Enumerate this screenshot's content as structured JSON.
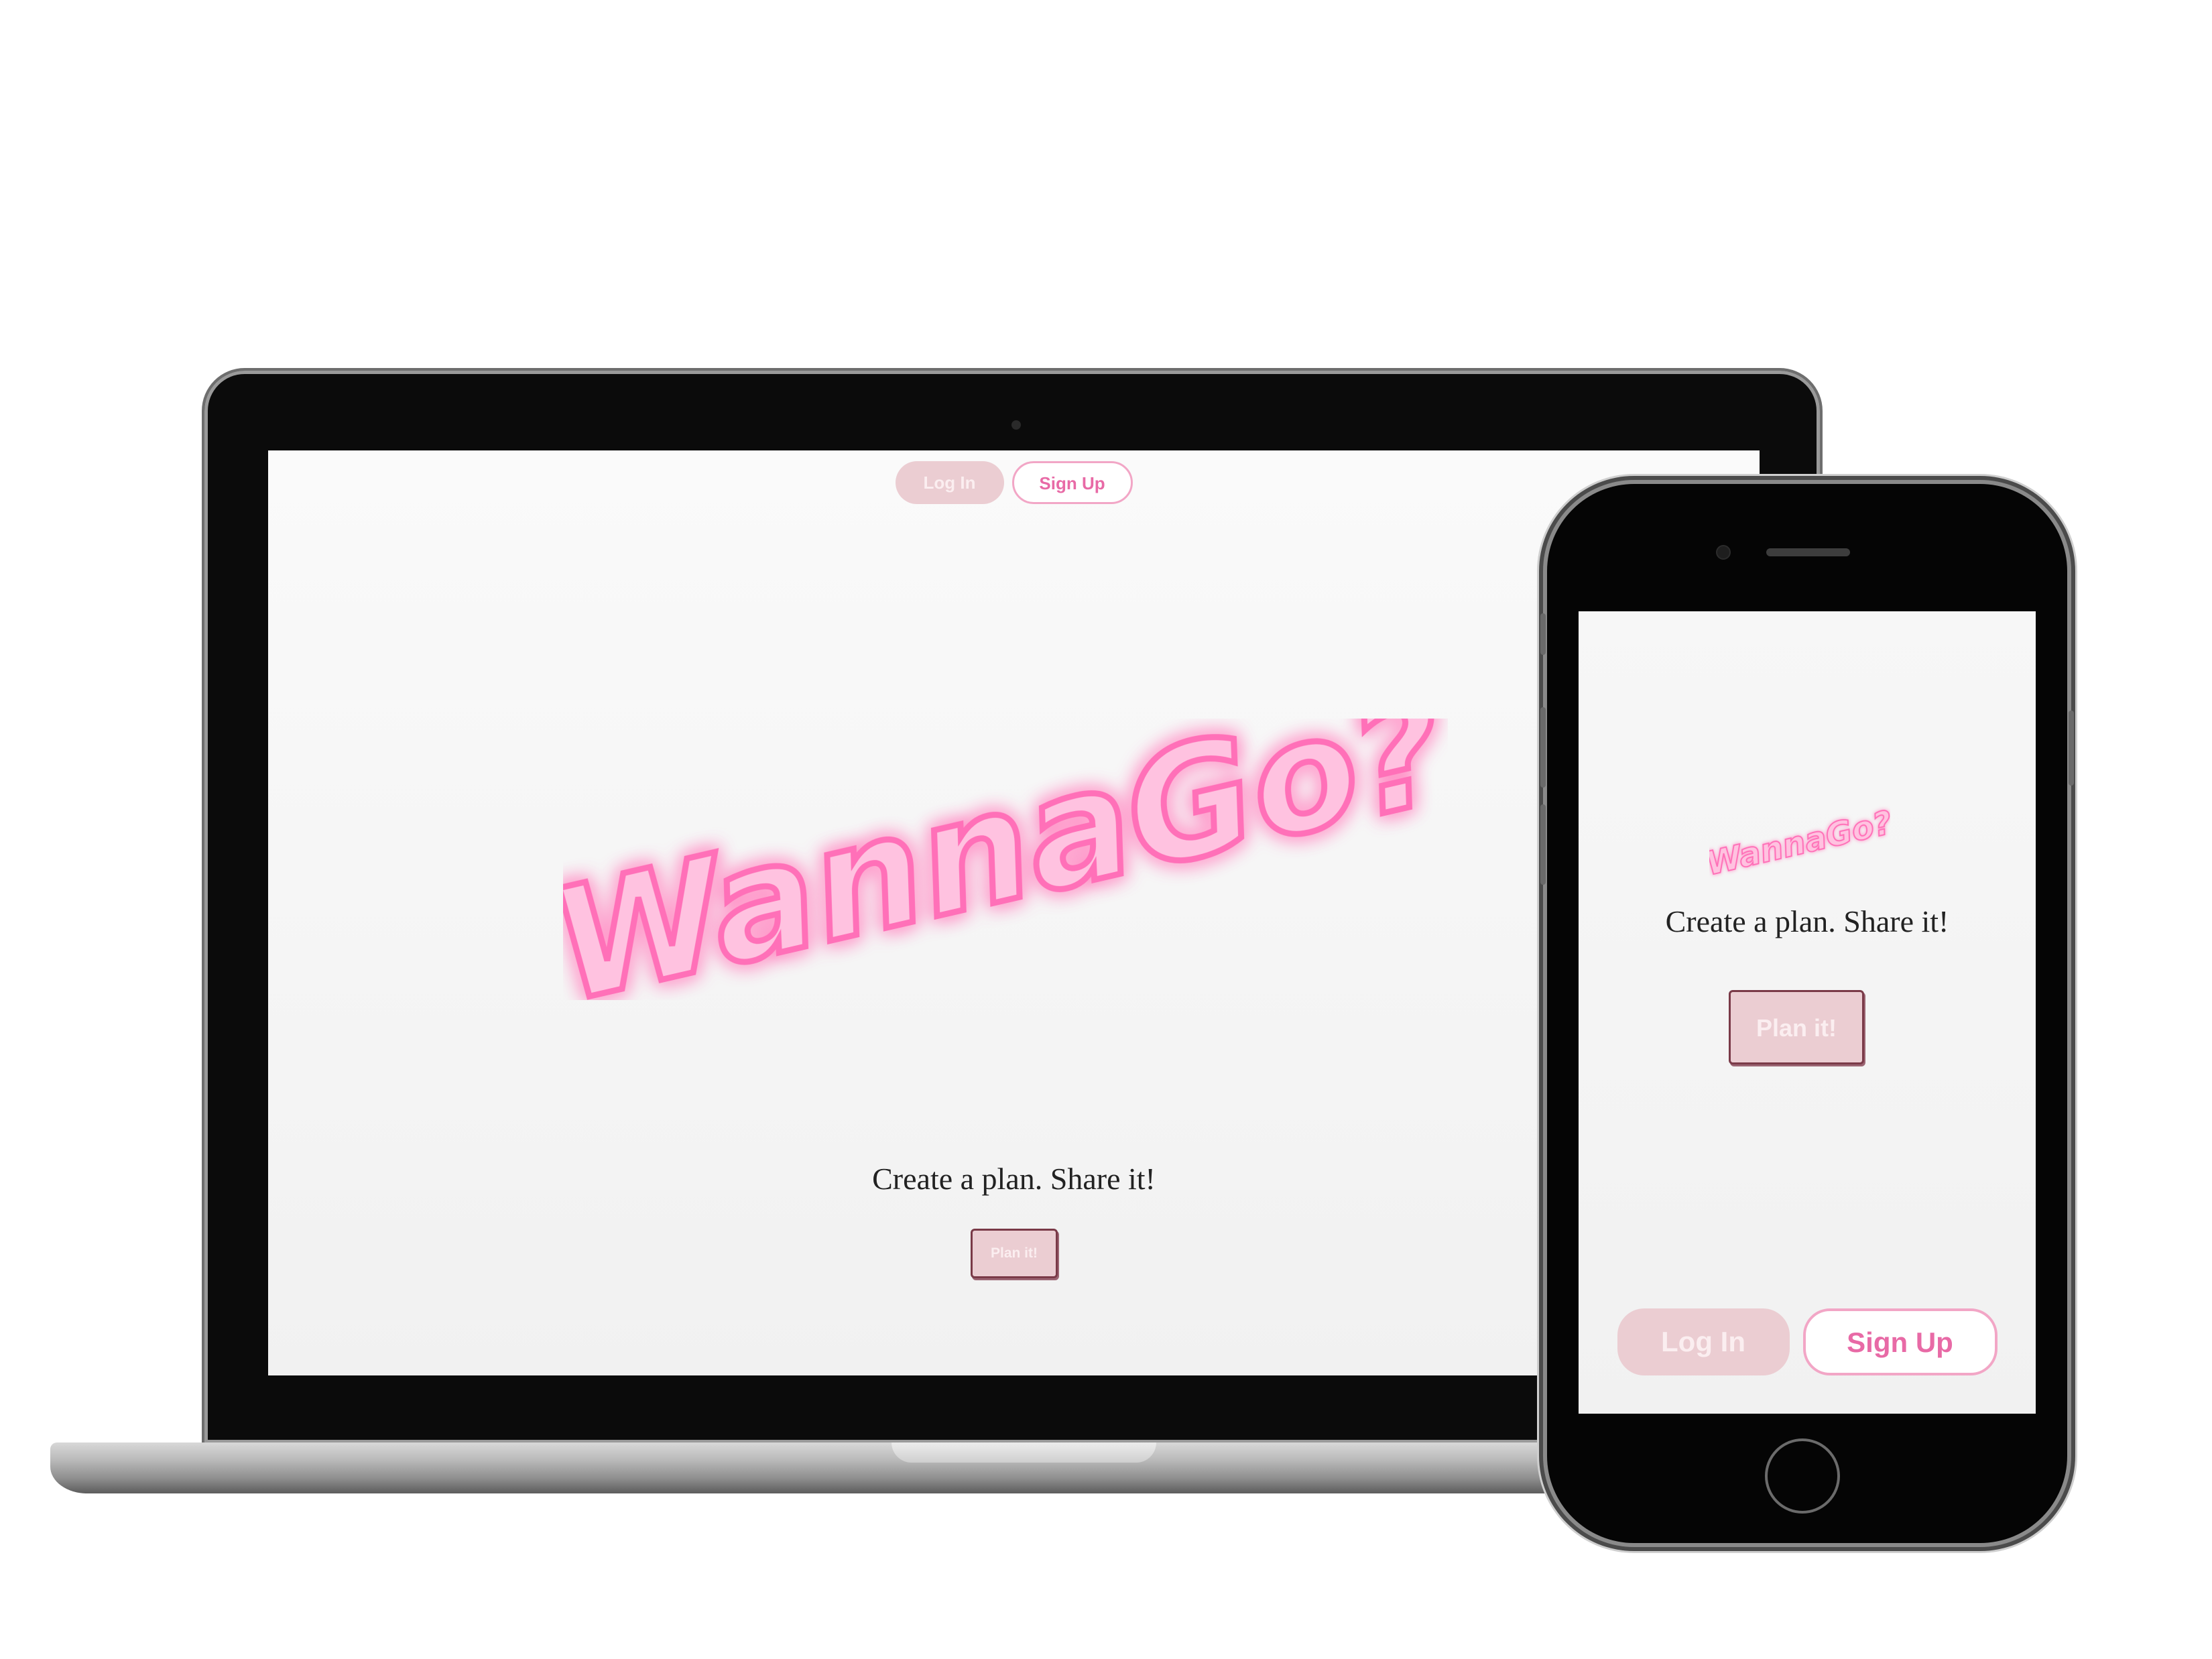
{
  "brand": {
    "logo_text": "WannaGo?",
    "neon_color": "#ff7ec1",
    "fill_color": "#ffc2e0"
  },
  "desktop": {
    "nav": {
      "login_label": "Log In",
      "signup_label": "Sign Up"
    },
    "tagline": "Create a plan. Share it!",
    "cta_label": "Plan it!"
  },
  "mobile": {
    "tagline": "Create a plan. Share it!",
    "cta_label": "Plan it!",
    "nav": {
      "login_label": "Log In",
      "signup_label": "Sign Up"
    }
  }
}
